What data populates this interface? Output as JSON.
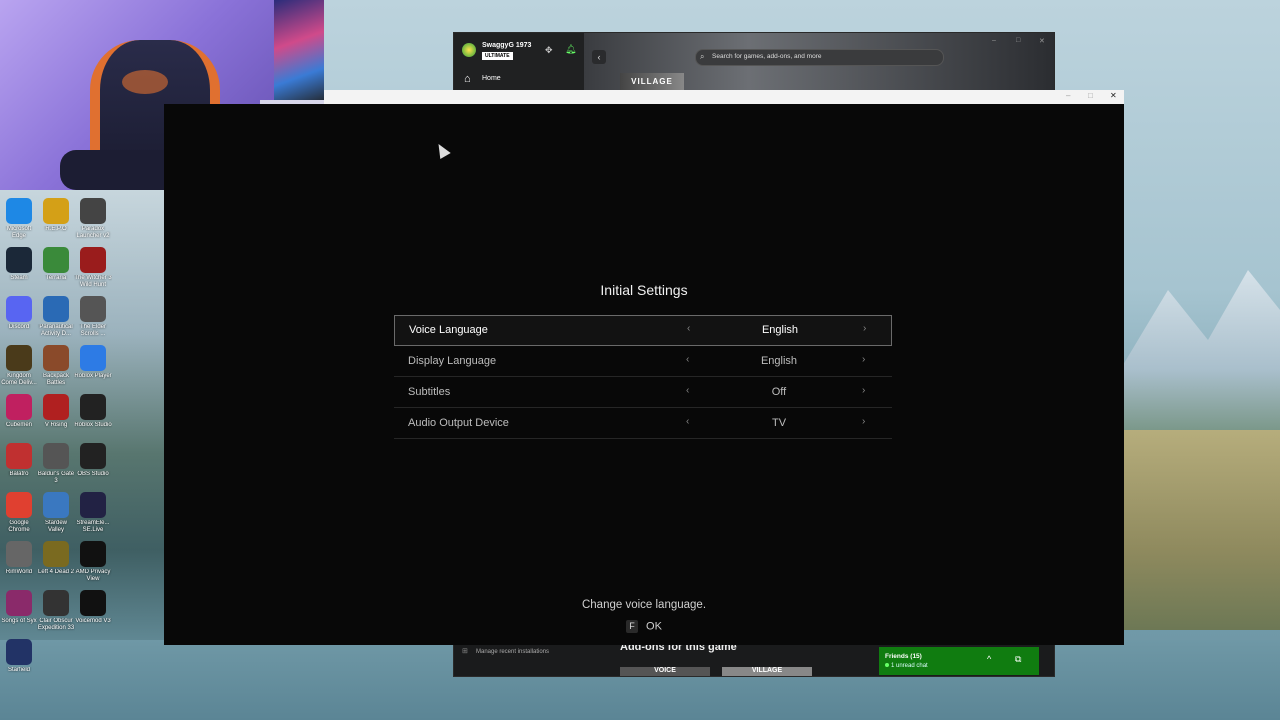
{
  "xbox_app": {
    "username": "SwaggyG 1973",
    "badge": "ULTIMATE",
    "nav_home": "Home",
    "search_placeholder": "Search for games, add-ons, and more",
    "village_label": "VILLAGE",
    "manage_installations": "Manage recent installations",
    "addons_heading": "Add-ons for this game",
    "thumb_labels": [
      "VOICE",
      "VILLAGE"
    ],
    "friends_title": "Friends (15)",
    "friends_sub": "1 unread chat"
  },
  "game": {
    "title": "Initial Settings",
    "settings": [
      {
        "label": "Voice Language",
        "value": "English",
        "selected": true
      },
      {
        "label": "Display Language",
        "value": "English",
        "selected": false
      },
      {
        "label": "Subtitles",
        "value": "Off",
        "selected": false
      },
      {
        "label": "Audio Output Device",
        "value": "TV",
        "selected": false
      }
    ],
    "arrow_left": "‹",
    "arrow_right": "›",
    "hint": "Change voice language.",
    "key": "F",
    "key_action": "OK"
  },
  "desktop_icons": [
    {
      "label": "Microsoft Edge",
      "icon": "edge-icon",
      "color": "#1e88e5"
    },
    {
      "label": "R.E.P.O",
      "icon": "repo-icon",
      "color": "#d4a017"
    },
    {
      "label": "Paradox Launcher v2",
      "icon": "paradox-icon",
      "color": "#444444"
    },
    {
      "label": "Steam",
      "icon": "steam-icon",
      "color": "#1b2838"
    },
    {
      "label": "Terraria",
      "icon": "terraria-icon",
      "color": "#3a8a3a"
    },
    {
      "label": "The Witcher 3 Wild Hunt",
      "icon": "witcher-icon",
      "color": "#9a1c1c"
    },
    {
      "label": "Discord",
      "icon": "discord-icon",
      "color": "#5865f2"
    },
    {
      "label": "Paranautical Activity D...",
      "icon": "paranautical-icon",
      "color": "#2a6ab5"
    },
    {
      "label": "The Elder Scrolls ...",
      "icon": "elder-scrolls-icon",
      "color": "#555555"
    },
    {
      "label": "Kingdom Come Deliv...",
      "icon": "kingdom-icon",
      "color": "#4a3a1a"
    },
    {
      "label": "Backpack Battles",
      "icon": "backpack-icon",
      "color": "#8a4a2a"
    },
    {
      "label": "Roblox Player",
      "icon": "roblox-icon",
      "color": "#2d7be5"
    },
    {
      "label": "Cubemen",
      "icon": "cubemen-icon",
      "color": "#c02060"
    },
    {
      "label": "V Rising",
      "icon": "vrising-icon",
      "color": "#b02020"
    },
    {
      "label": "Roblox Studio",
      "icon": "roblox-studio-icon",
      "color": "#222222"
    },
    {
      "label": "Balatro",
      "icon": "balatro-icon",
      "color": "#c03030"
    },
    {
      "label": "Baldur's Gate 3",
      "icon": "baldurs-gate-icon",
      "color": "#555555"
    },
    {
      "label": "OBS Studio",
      "icon": "obs-icon",
      "color": "#222222"
    },
    {
      "label": "Google Chrome",
      "icon": "chrome-icon",
      "color": "#e04030"
    },
    {
      "label": "Stardew Valley",
      "icon": "stardew-icon",
      "color": "#3a78c0"
    },
    {
      "label": "StreamEle... SE.Live",
      "icon": "streamelements-icon",
      "color": "#222244"
    },
    {
      "label": "RimWorld",
      "icon": "rimworld-icon",
      "color": "#666666"
    },
    {
      "label": "Left 4 Dead 2",
      "icon": "l4d2-icon",
      "color": "#7a6a20"
    },
    {
      "label": "AMD Privacy View",
      "icon": "amd-icon",
      "color": "#111111"
    },
    {
      "label": "Songs of Syx",
      "icon": "syx-icon",
      "color": "#8a2a6a"
    },
    {
      "label": "Clair Obscur Expedition 33",
      "icon": "clair-icon",
      "color": "#333333"
    },
    {
      "label": "Voicemod V3",
      "icon": "voicemod-icon",
      "color": "#111111"
    },
    {
      "label": "Starfield",
      "icon": "starfield-icon",
      "color": "#223366"
    }
  ]
}
